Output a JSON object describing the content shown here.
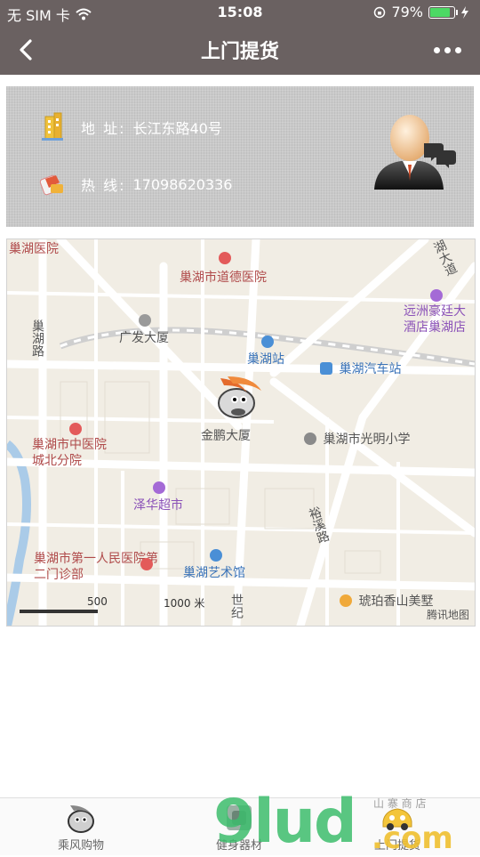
{
  "status_bar": {
    "carrier": "无 SIM 卡",
    "time": "15:08",
    "battery": "79%",
    "battery_level": 0.79
  },
  "nav": {
    "title": "上门提货",
    "back_icon": "chevron-left-icon",
    "more_icon": "more-dots-icon"
  },
  "store": {
    "address_label": "地 址:",
    "address": "长江东路40号",
    "phone_label": "热 线:",
    "phone": "17098620336",
    "address_icon": "building-icon",
    "phone_icon": "phone-icon",
    "contact_icon": "customer-service-avatar-icon"
  },
  "map": {
    "labels": [
      {
        "text": "巢湖医院",
        "color": "red"
      },
      {
        "text": "巢湖市道德医院",
        "color": "red"
      },
      {
        "text": "巢湖路",
        "color": "grey"
      },
      {
        "text": "广发大厦",
        "color": "grey"
      },
      {
        "text": "巢湖站",
        "color": "blue"
      },
      {
        "text": "巢湖汽车站",
        "color": "blue"
      },
      {
        "text": "远洲豪廷大酒店巢湖店",
        "color": "purple"
      },
      {
        "text": "金鹏大厦",
        "color": "grey"
      },
      {
        "text": "巢湖市光明小学",
        "color": "grey"
      },
      {
        "text": "巢湖市中医院城北分院",
        "color": "red"
      },
      {
        "text": "泽华超市",
        "color": "purple"
      },
      {
        "text": "巢湖市第一人民医院第二门诊部",
        "color": "red"
      },
      {
        "text": "巢湖艺术馆",
        "color": "blue"
      },
      {
        "text": "琥珀香山美墅",
        "color": "grey"
      },
      {
        "text": "裕溪路",
        "color": "grey"
      },
      {
        "text": "世纪",
        "color": "grey"
      },
      {
        "text": "湖大道",
        "color": "grey"
      }
    ],
    "scale_500": "500",
    "scale_1000": "1000 米",
    "brand": "腾讯地图",
    "marker_icon": "store-mascot-marker-icon"
  },
  "tabbar": {
    "tabs": [
      {
        "label": "乘风购物",
        "icon": "mascot-icon"
      },
      {
        "label": "健身器材",
        "icon": "fitness-equipment-icon"
      },
      {
        "label": "上门提货",
        "icon": "pickup-car-icon"
      }
    ]
  },
  "watermark": {
    "text": "9lud",
    "sub": ".com",
    "small": "山 寨 商 店"
  },
  "colors": {
    "bar": "#6a6161",
    "card": "#c9c9c9",
    "map_bg": "#f1ede4"
  }
}
